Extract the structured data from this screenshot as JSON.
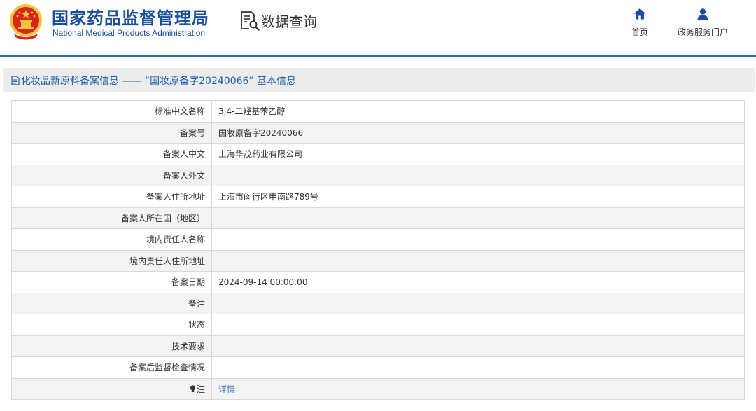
{
  "header": {
    "agency_name_cn": "国家药品监督管理局",
    "agency_name_en": "National Medical Products Administration",
    "query_title": "数据查询",
    "nav": {
      "home_label": "首页",
      "portal_label": "政务服务门户"
    }
  },
  "info_bar": {
    "title": "化妆品新原料备案信息 —— “国妆原备字20240066” 基本信息"
  },
  "detail": {
    "rows": [
      {
        "label": "标准中文名称",
        "value": "3,4-二羟基苯乙醇"
      },
      {
        "label": "备案号",
        "value": "国妆原备字20240066"
      },
      {
        "label": "备案人中文",
        "value": "上海华茂药业有限公司"
      },
      {
        "label": "备案人外文",
        "value": ""
      },
      {
        "label": "备案人住所地址",
        "value": "上海市闵行区申南路789号"
      },
      {
        "label": "备案人所在国（地区）",
        "value": ""
      },
      {
        "label": "境内责任人名称",
        "value": ""
      },
      {
        "label": "境内责任人住所地址",
        "value": ""
      },
      {
        "label": "备案日期",
        "value": "2024-09-14 00:00:00"
      },
      {
        "label": "备注",
        "value": ""
      },
      {
        "label": "状态",
        "value": ""
      },
      {
        "label": "技术要求",
        "value": ""
      },
      {
        "label": "备案后监督检查情况",
        "value": ""
      }
    ],
    "note_row": {
      "label": "注",
      "link_label": "详情"
    }
  },
  "colors": {
    "brand_blue": "#1b4f9c",
    "link_blue": "#2a6cc0",
    "header_rule": "#2f68b4",
    "row_alt": "#f3f3f3",
    "emblem_red": "#d8261c",
    "emblem_gold": "#f3c23c"
  },
  "icons": {
    "emblem": "national-emblem-icon",
    "query": "document-search-icon",
    "home": "home-icon",
    "portal": "user-icon",
    "info": "document-icon",
    "note": "lightbulb-icon"
  }
}
